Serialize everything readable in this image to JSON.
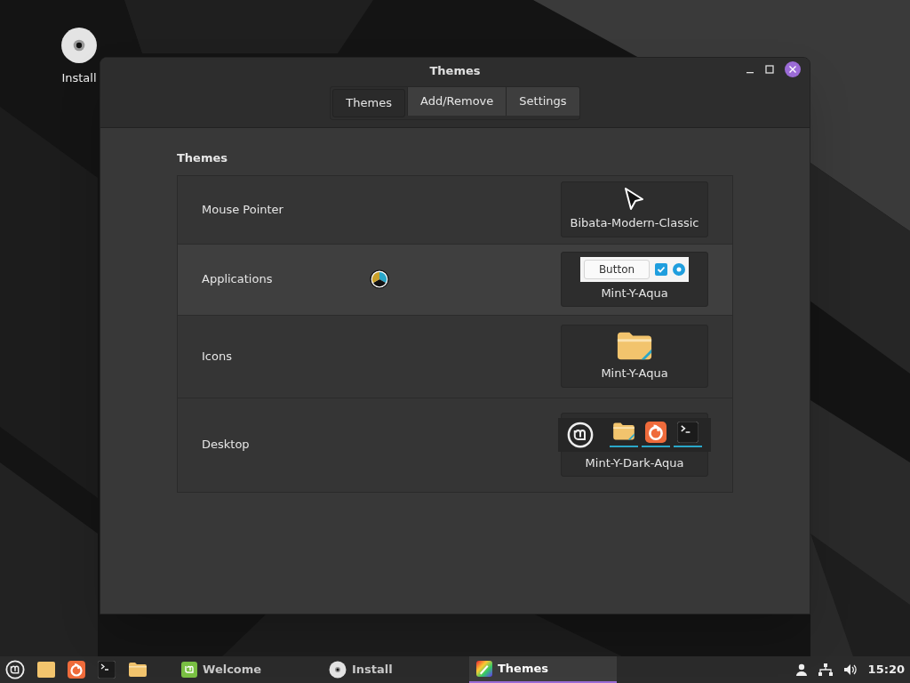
{
  "desktop_icons": [
    {
      "label": "Install"
    }
  ],
  "window": {
    "title": "Themes",
    "tabs": [
      {
        "label": "Themes",
        "selected": true
      },
      {
        "label": "Add/Remove",
        "selected": false
      },
      {
        "label": "Settings",
        "selected": false
      }
    ],
    "section_title": "Themes",
    "rows": [
      {
        "label": "Mouse Pointer",
        "kind": "cursor",
        "theme": "Bibata-Modern-Classic",
        "highlighted": false
      },
      {
        "label": "Applications",
        "kind": "gtk",
        "theme": "Mint-Y-Aqua",
        "highlighted": true,
        "preview_button": "Button"
      },
      {
        "label": "Icons",
        "kind": "icons",
        "theme": "Mint-Y-Aqua",
        "highlighted": false
      },
      {
        "label": "Desktop",
        "kind": "desktop",
        "theme": "Mint-Y-Dark-Aqua",
        "highlighted": false
      }
    ]
  },
  "taskbar": {
    "launchers": [
      {
        "kind": "menu"
      },
      {
        "kind": "files"
      },
      {
        "kind": "browser"
      },
      {
        "kind": "terminal"
      },
      {
        "kind": "folder"
      }
    ],
    "tasks": [
      {
        "label": "Welcome",
        "kind": "welcome",
        "selected": false
      },
      {
        "label": "Install",
        "kind": "disc",
        "selected": false
      },
      {
        "label": "Themes",
        "kind": "themes",
        "selected": true
      }
    ],
    "clock": "15:20"
  }
}
